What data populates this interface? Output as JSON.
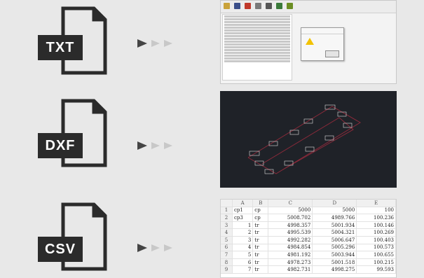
{
  "rows": [
    {
      "badge": "TXT"
    },
    {
      "badge": "DXF"
    },
    {
      "badge": "CSV"
    }
  ],
  "colors": {
    "background": "#e8e8e8",
    "icon": "#2b2b2b",
    "arrow": "#444444",
    "arrow_light": "#c8c8c8",
    "cad_bg": "#1f2228"
  },
  "spreadsheet": {
    "columns": [
      "",
      "A",
      "B",
      "C",
      "D",
      "E"
    ],
    "rows": [
      [
        "1",
        "cp1",
        "cp",
        "5000",
        "5000",
        "100"
      ],
      [
        "2",
        "cp3",
        "cp",
        "5008.702",
        "4989.766",
        "100.236"
      ],
      [
        "3",
        "1",
        "tr",
        "4998.357",
        "5001.934",
        "100.146"
      ],
      [
        "4",
        "2",
        "tr",
        "4995.539",
        "5004.321",
        "100.269"
      ],
      [
        "5",
        "3",
        "tr",
        "4992.282",
        "5006.647",
        "100.403"
      ],
      [
        "6",
        "4",
        "tr",
        "4984.854",
        "5005.296",
        "100.573"
      ],
      [
        "7",
        "5",
        "tr",
        "4981.192",
        "5003.944",
        "100.655"
      ],
      [
        "8",
        "6",
        "tr",
        "4978.273",
        "5001.518",
        "100.215"
      ],
      [
        "9",
        "7",
        "tr",
        "4982.731",
        "4998.275",
        "99.593"
      ]
    ]
  }
}
